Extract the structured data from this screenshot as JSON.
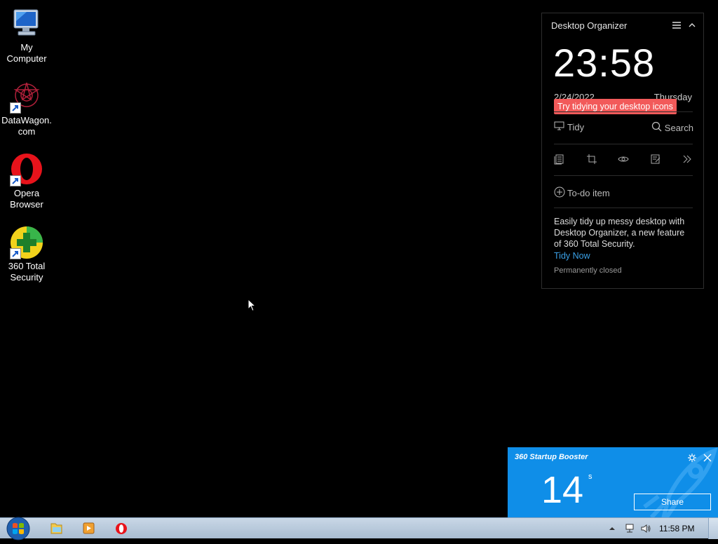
{
  "desktop_icons": [
    {
      "label": "My\nComputer",
      "icon": "computer-icon"
    },
    {
      "label": "DataWagon.\ncom",
      "icon": "datawagon-icon"
    },
    {
      "label": "Opera\nBrowser",
      "icon": "opera-icon"
    },
    {
      "label": "360 Total\nSecurity",
      "icon": "360-security-icon"
    }
  ],
  "organizer": {
    "title": "Desktop Organizer",
    "clock": "23:58",
    "date": "2/24/2022",
    "day": "Thursday",
    "tip": "Try tidying your desktop icons",
    "tidy_label": "Tidy",
    "search_label": "Search",
    "todo_label": "To-do item",
    "description": "Easily tidy up messy desktop with Desktop Organizer, a new feature of 360 Total Security.",
    "tidy_now_label": "Tidy Now",
    "closed_label": "Permanently closed"
  },
  "booster": {
    "title": "360 Startup Booster",
    "value": "14",
    "unit": "s",
    "share_label": "Share"
  },
  "taskbar": {
    "clock": "11:58 PM",
    "apps": [
      "file-explorer-icon",
      "media-player-icon",
      "opera-icon"
    ]
  },
  "colors": {
    "tip_bg": "#f25a5a",
    "link": "#3aa0e6",
    "booster_bg": "#0f8ee8"
  }
}
